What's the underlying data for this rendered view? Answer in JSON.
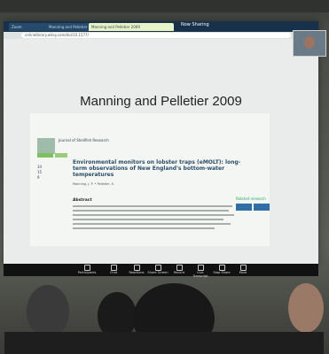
{
  "slide": {
    "title": "Manning and Pelletier 2009"
  },
  "browser": {
    "tabs": [
      "Zoom",
      "Manning and Pelletier 2009",
      "Now Sharing"
    ],
    "url": "onlinelibrary.wiley.com/doi/10.1577/"
  },
  "article": {
    "journal": "Journal of Shellfish Research",
    "title": "Environmental monitors on lobster traps (eMOLT): long-term observations of New England's bottom-water temperatures",
    "authors": "Manning, J. P. • Pelletier, E.",
    "abstract_heading": "Abstract",
    "metrics": [
      "34",
      "15",
      "9"
    ],
    "side_heading": "Related research"
  },
  "toolbar": {
    "items": [
      "Participants",
      "Chat",
      "Reactions",
      "Share Screen",
      "Record",
      "Live Transcript",
      "Stop Share",
      "More"
    ]
  }
}
